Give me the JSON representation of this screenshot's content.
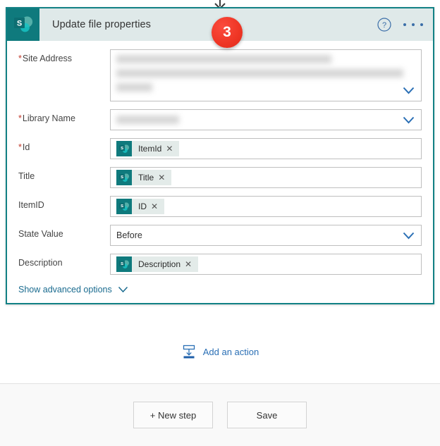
{
  "connector": {
    "arrow_icon": "arrow-down-icon"
  },
  "card": {
    "step_badge": "3",
    "logo_icon": "sharepoint-logo-icon",
    "title": "Update file properties",
    "help_icon": "help-circle-icon",
    "more_icon": "ellipsis-icon",
    "fields": [
      {
        "label": "Site Address",
        "required": true,
        "type": "combo-tall",
        "value": "",
        "redacted_lines": 3,
        "chevron_icon": "chevron-down-icon"
      },
      {
        "label": "Library Name",
        "required": true,
        "type": "combo",
        "value": "",
        "redacted_lines": 1,
        "chevron_icon": "chevron-down-icon"
      },
      {
        "label": "Id",
        "required": true,
        "type": "token",
        "token": "ItemId",
        "token_icon": "sharepoint-logo-icon",
        "remove_icon": "close-icon"
      },
      {
        "label": "Title",
        "required": false,
        "type": "token",
        "token": "Title",
        "token_icon": "sharepoint-logo-icon",
        "remove_icon": "close-icon"
      },
      {
        "label": "ItemID",
        "required": false,
        "type": "token",
        "token": "ID",
        "token_icon": "sharepoint-logo-icon",
        "remove_icon": "close-icon"
      },
      {
        "label": "State Value",
        "required": false,
        "type": "select",
        "value": "Before",
        "chevron_icon": "chevron-down-icon"
      },
      {
        "label": "Description",
        "required": false,
        "type": "token",
        "token": "Description",
        "token_icon": "sharepoint-logo-icon",
        "remove_icon": "close-icon"
      }
    ],
    "advanced_options_label": "Show advanced options",
    "advanced_options_icon": "chevron-down-icon"
  },
  "add_action": {
    "label": "Add an action",
    "icon": "insert-below-icon"
  },
  "footer": {
    "new_step_label": "+ New step",
    "save_label": "Save"
  },
  "colors": {
    "accent_teal": "#128185",
    "logo_teal": "#0f7a7d",
    "header_bar": "#dfe9e9",
    "badge_red": "#ee3524",
    "link_blue": "#2a6fb5",
    "required_red": "#c0392b"
  }
}
